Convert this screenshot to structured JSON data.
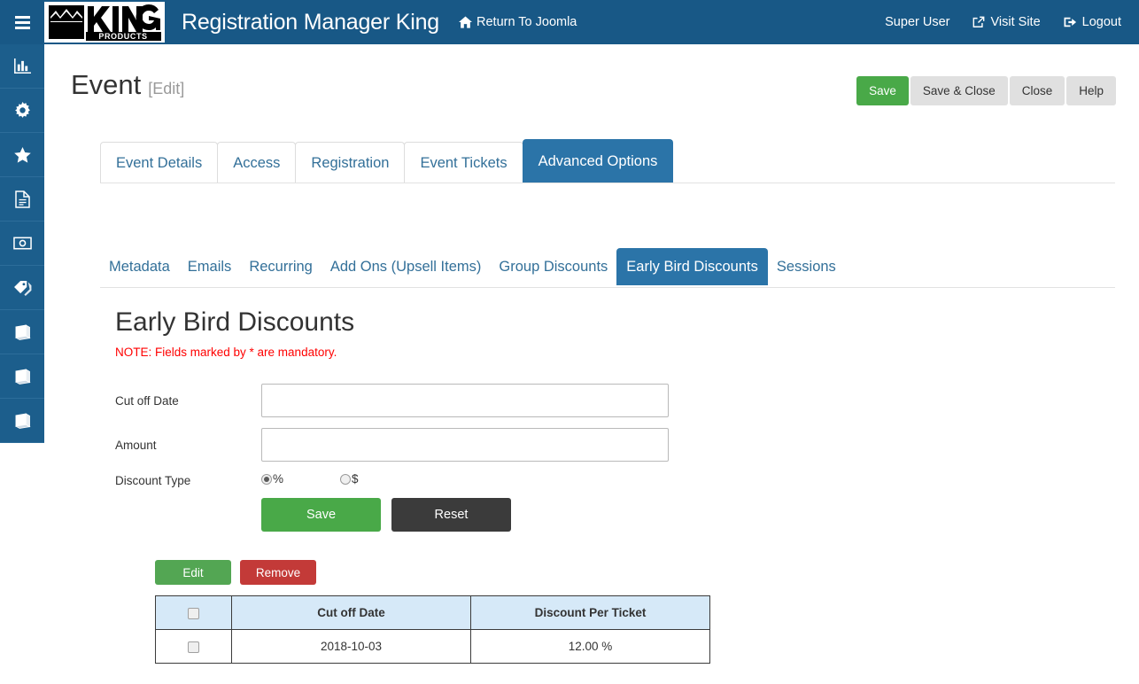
{
  "topbar": {
    "menu_icon": "hamburger-icon",
    "logo_primary": "KING",
    "logo_secondary": "PRODUCTS",
    "app_title": "Registration Manager King",
    "return_label": "Return To Joomla",
    "return_icon": "home-icon",
    "user_label": "Super User",
    "visit_label": "Visit Site",
    "visit_icon": "external-link-icon",
    "logout_label": "Logout",
    "logout_icon": "sign-out-icon",
    "bg_color": "#185886"
  },
  "sidebar": {
    "bg_color": "#1C5E8C",
    "items": [
      {
        "icon": "chart-bar-icon"
      },
      {
        "icon": "gear-icon"
      },
      {
        "icon": "star-icon"
      },
      {
        "icon": "file-invoice-icon"
      },
      {
        "icon": "money-bill-icon"
      },
      {
        "icon": "tag-icon"
      },
      {
        "icon": "book-icon"
      },
      {
        "icon": "book-icon"
      },
      {
        "icon": "book-icon"
      }
    ]
  },
  "page": {
    "title": "Event",
    "title_suffix": "[Edit]"
  },
  "toolbar": {
    "save_label": "Save",
    "save_close_label": "Save & Close",
    "close_label": "Close",
    "help_label": "Help",
    "primary_color": "#49a948"
  },
  "tabs": [
    {
      "label": "Event Details",
      "active": false
    },
    {
      "label": "Access",
      "active": false
    },
    {
      "label": "Registration",
      "active": false
    },
    {
      "label": "Event Tickets",
      "active": false
    },
    {
      "label": "Advanced Options",
      "active": true
    }
  ],
  "subtabs": [
    {
      "label": "Metadata",
      "active": false
    },
    {
      "label": "Emails",
      "active": false
    },
    {
      "label": "Recurring",
      "active": false
    },
    {
      "label": "Add Ons (Upsell Items)",
      "active": false
    },
    {
      "label": "Group Discounts",
      "active": false
    },
    {
      "label": "Early Bird Discounts",
      "active": true
    },
    {
      "label": "Sessions",
      "active": false
    }
  ],
  "section": {
    "heading": "Early Bird Discounts",
    "note": "NOTE: Fields marked by * are mandatory.",
    "note_color": "#ff0000"
  },
  "form": {
    "cutoff_label": "Cut off Date",
    "cutoff_value": "",
    "cutoff_placeholder": "",
    "amount_label": "Amount",
    "amount_value": "",
    "amount_placeholder": "",
    "discount_type_label": "Discount Type",
    "discount_options": [
      {
        "label": "%",
        "selected": true
      },
      {
        "label": "$",
        "selected": false
      }
    ],
    "save_label": "Save",
    "reset_label": "Reset",
    "save_color": "#49a948",
    "reset_color": "#3b3b3b"
  },
  "list": {
    "edit_label": "Edit",
    "remove_label": "Remove",
    "edit_color": "#53a653",
    "remove_color": "#c33a38",
    "columns": [
      "",
      "Cut off Date",
      "Discount Per Ticket"
    ],
    "rows": [
      {
        "checked": false,
        "cutoff_date": "2018-10-03",
        "discount": "12.00 %"
      }
    ],
    "header_bg": "#d6e9f8"
  }
}
